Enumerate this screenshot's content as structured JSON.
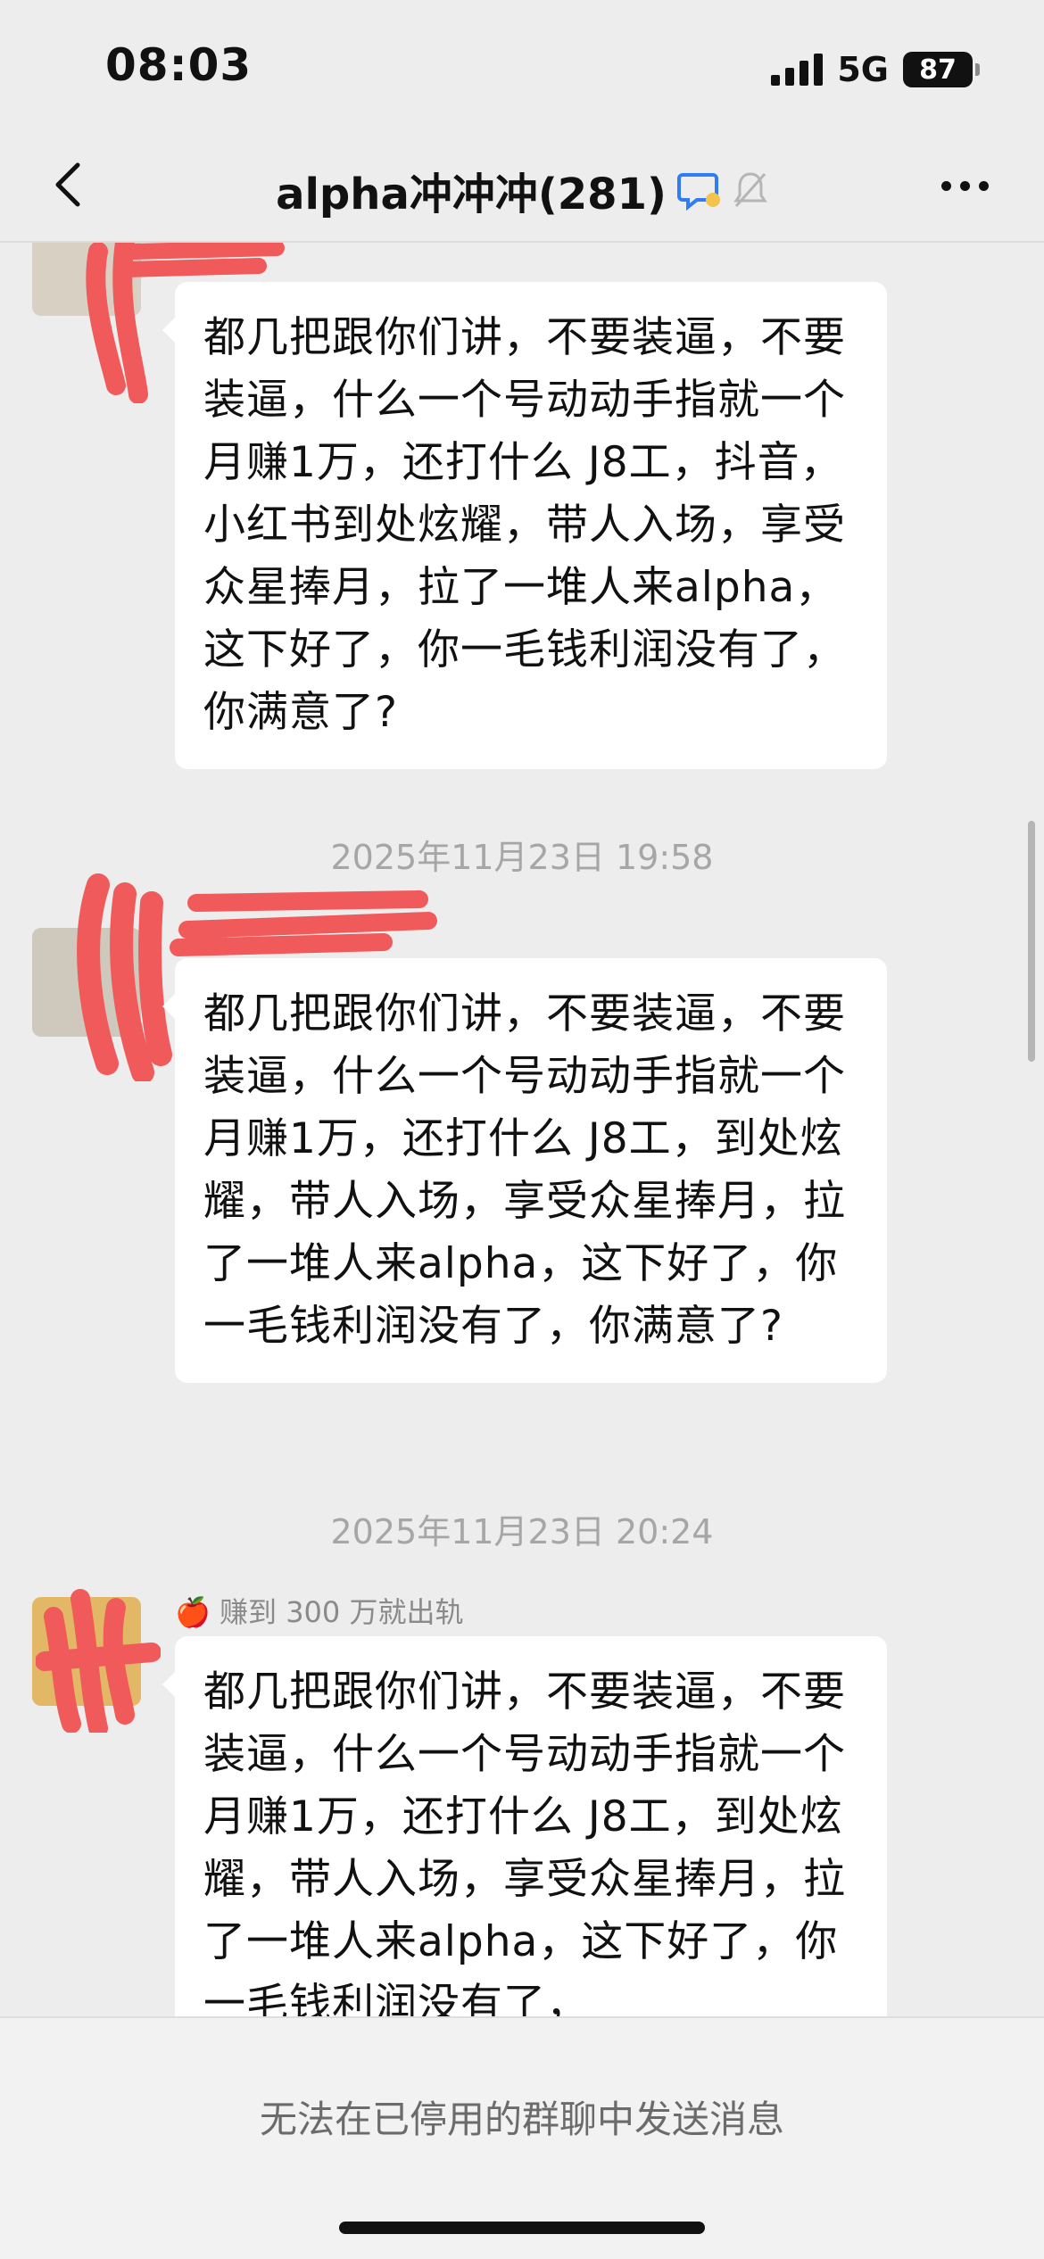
{
  "status_bar": {
    "time": "08:03",
    "network": "5G",
    "battery": "87"
  },
  "nav": {
    "title": "alpha冲冲冲(281)",
    "back_icon": "chevron-left-icon",
    "more_icon": "more-dots-icon"
  },
  "chat": {
    "messages": [
      {
        "text": "都几把跟你们讲，不要装逼，不要装逼，什么一个号动动手指就一个月赚1万，还打什么 J8工，抖音，小红书到处炫耀，带人入场，享受众星捧月，拉了一堆人来alpha，这下好了，你一毛钱利润没有了，你满意了?"
      },
      {
        "timestamp": "2025年11月23日 19:58",
        "text": "都几把跟你们讲，不要装逼，不要装逼，什么一个号动动手指就一个月赚1万，还打什么 J8工，到处炫耀，带人入场，享受众星捧月，拉了一堆人来alpha，这下好了，你一毛钱利润没有了，你满意了?"
      },
      {
        "timestamp": "2025年11月23日 20:24",
        "sender": "赚到 300 万就出轨",
        "text": "都几把跟你们讲，不要装逼，不要装逼，什么一个号动动手指就一个月赚1万，还打什么 J8工，到处炫耀，带人入场，享受众星捧月，拉了一堆人来alpha，这下好了，你一毛钱利润没有了，"
      }
    ]
  },
  "bottom": {
    "notice": "无法在已停用的群聊中发送消息"
  },
  "colors": {
    "background": "#ededed",
    "bubble": "#ffffff",
    "redaction": "#f05a5a"
  }
}
